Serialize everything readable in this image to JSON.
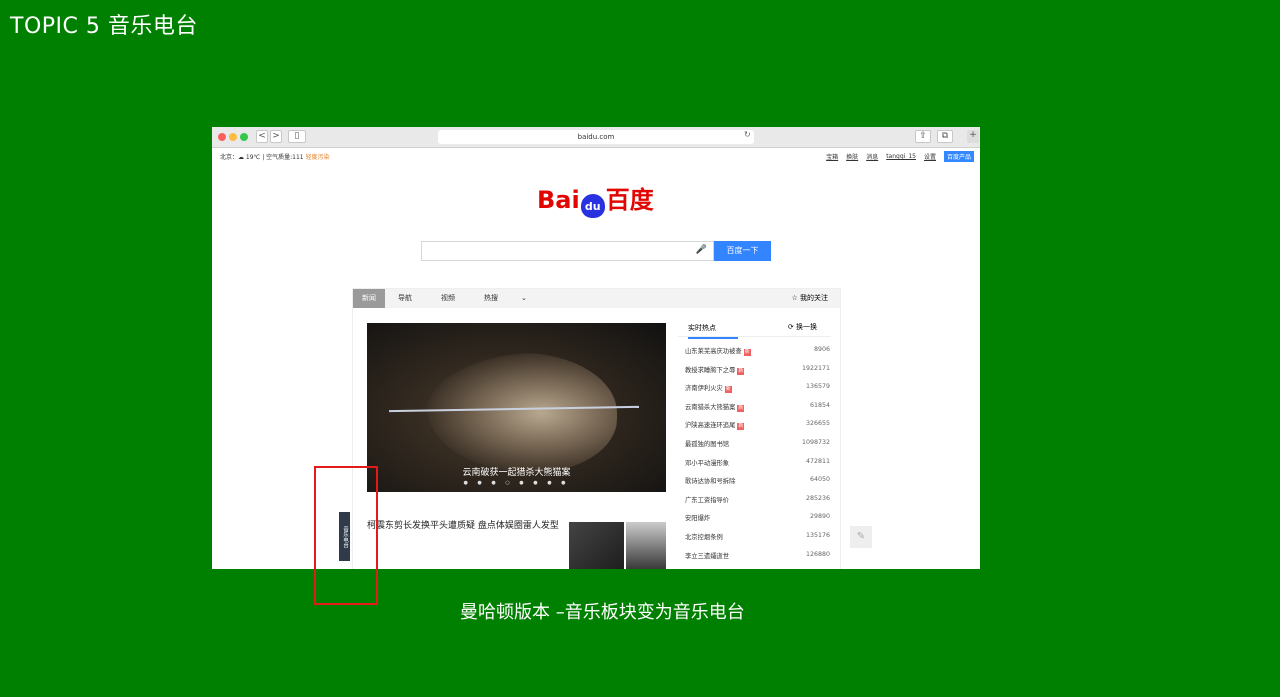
{
  "topic": "TOPIC 5 音乐电台",
  "caption": "曼哈顿版本 –音乐板块变为音乐电台",
  "browser": {
    "url": "baidu.com",
    "back": "<",
    "forward": ">",
    "sidebar": "▯",
    "reload": "↻"
  },
  "topbar": {
    "weather": "北京：☁ 19℃ | 空气质量:111",
    "pollution": "轻度污染",
    "links": [
      "宝箱",
      "换肤",
      "消息",
      "tangqi_15",
      "设置"
    ],
    "product": "百度产品"
  },
  "logo": {
    "left": "Bai",
    "paw": "du",
    "right": "百度"
  },
  "search": {
    "button": "百度一下",
    "mic": "🎤"
  },
  "feed": {
    "tabs": [
      "新闻",
      "导航",
      "视频",
      "热搜"
    ],
    "more": "⌄",
    "follow": "☆ 我的关注",
    "image_caption": "云南破获一起猎杀大熊猫案",
    "dots": "● ● ● ○ ● ● ● ●",
    "headline": "柯震东剪长发换平头遭质疑 盘点体娱圈雷人发型",
    "hot_title": "实时热点",
    "refresh": "⟳ 换一换",
    "hot": [
      {
        "t": "山东莱芜高庆功被查",
        "n": "8906",
        "new": true
      },
      {
        "t": "教授求睡胯下之辱",
        "n": "1922171",
        "new": true
      },
      {
        "t": "济南伊利火灾",
        "n": "136579",
        "new": true
      },
      {
        "t": "云南猎杀大熊猫案",
        "n": "61854",
        "new": true
      },
      {
        "t": "沪陕高速连环追尾",
        "n": "326655",
        "new": true
      },
      {
        "t": "最孤独的图书馆",
        "n": "1098732",
        "new": false
      },
      {
        "t": "邓小平动漫形象",
        "n": "472811",
        "new": false
      },
      {
        "t": "歌诗达协和号拆除",
        "n": "64050",
        "new": false
      },
      {
        "t": "广东工资指导价",
        "n": "285236",
        "new": false
      },
      {
        "t": "安阳爆炸",
        "n": "29890",
        "new": false
      },
      {
        "t": "北京控烟条例",
        "n": "135176",
        "new": false
      },
      {
        "t": "李立三遗孀逝世",
        "n": "126880",
        "new": false
      }
    ],
    "new_badge": "新"
  },
  "music_tab": "音乐电台",
  "edit_icon": "✎"
}
